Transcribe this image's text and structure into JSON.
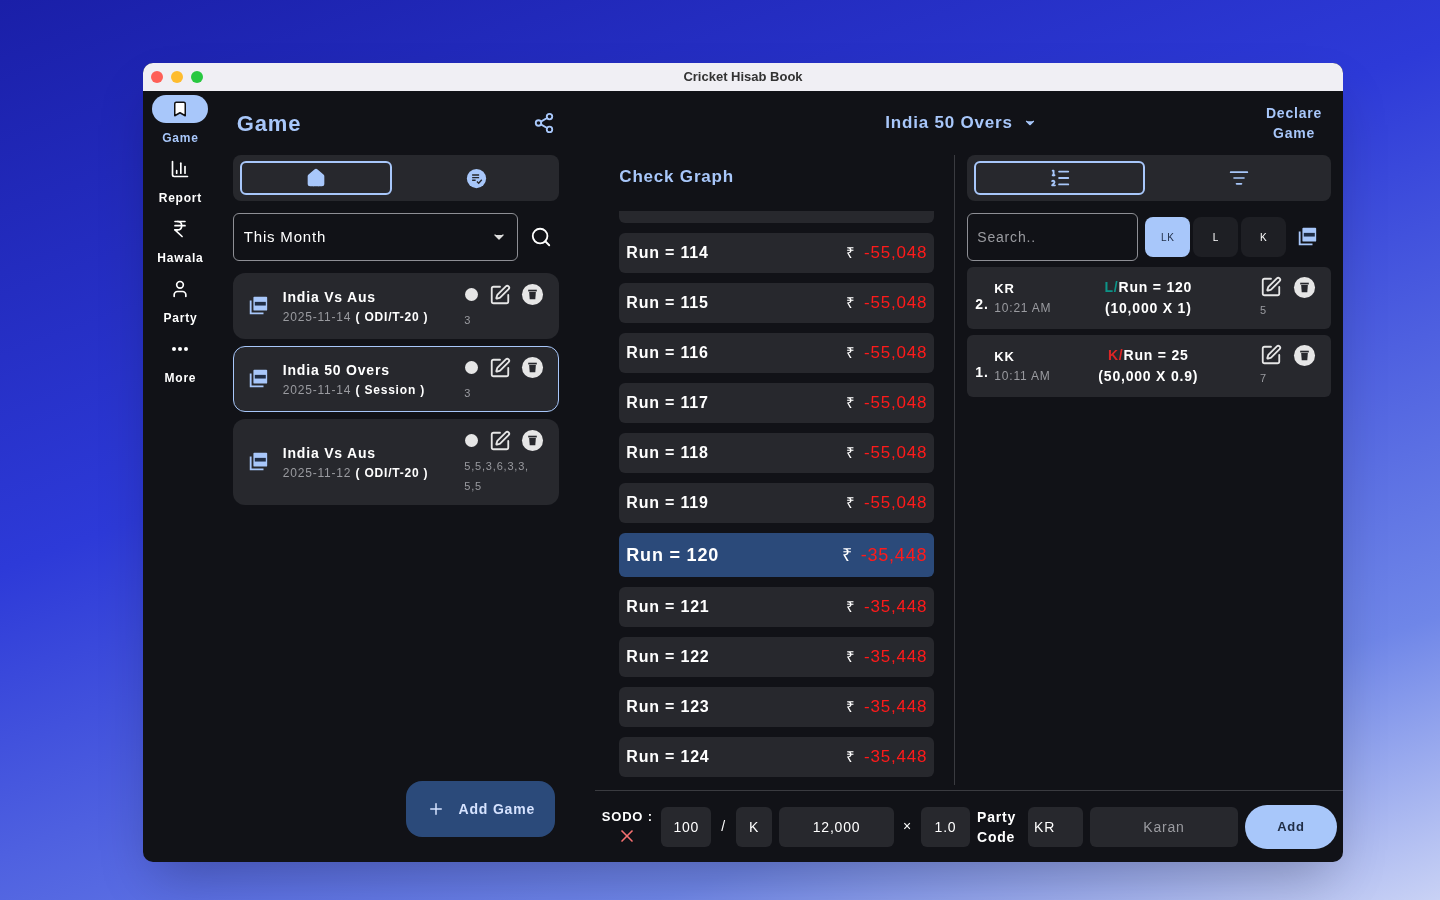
{
  "window": {
    "title": "Cricket Hisab Book"
  },
  "nav": [
    {
      "label": "Game",
      "kind": "book",
      "selected": true
    },
    {
      "label": "Report",
      "kind": "chart",
      "selected": false
    },
    {
      "label": "Hawala",
      "kind": "rupee",
      "selected": false
    },
    {
      "label": "Party",
      "kind": "person",
      "selected": false
    },
    {
      "label": "More",
      "kind": "more",
      "selected": false
    }
  ],
  "left": {
    "title": "Game",
    "tabs": [
      {
        "kind": "home",
        "selected": true
      },
      {
        "kind": "receipt",
        "selected": false
      }
    ],
    "period": {
      "value": "This Month"
    },
    "games": [
      {
        "name": "India Vs Aus",
        "date": "2025-11-14",
        "type": "( ODI/T-20 )",
        "note": "3",
        "selected": false
      },
      {
        "name": "India 50 Overs",
        "date": "2025-11-14",
        "type": "( Session )",
        "note": "3",
        "selected": true
      },
      {
        "name": "India Vs Aus",
        "date": "2025-11-12",
        "type": "( ODI/T-20 )",
        "note": "5,5,3,6,3,3, 5,5",
        "selected": false
      }
    ],
    "add_button": "Add Game"
  },
  "header": {
    "game": "India 50 Overs",
    "declare": "Declare Game"
  },
  "graph": {
    "title": "Check Graph",
    "rows": [
      {
        "run": "Run = 114",
        "currency": "₹",
        "amount": "-55,048",
        "selected": false
      },
      {
        "run": "Run = 115",
        "currency": "₹",
        "amount": "-55,048",
        "selected": false
      },
      {
        "run": "Run = 116",
        "currency": "₹",
        "amount": "-55,048",
        "selected": false
      },
      {
        "run": "Run = 117",
        "currency": "₹",
        "amount": "-55,048",
        "selected": false
      },
      {
        "run": "Run = 118",
        "currency": "₹",
        "amount": "-55,048",
        "selected": false
      },
      {
        "run": "Run = 119",
        "currency": "₹",
        "amount": "-55,048",
        "selected": false
      },
      {
        "run": "Run = 120",
        "currency": "₹",
        "amount": "-35,448",
        "selected": true
      },
      {
        "run": "Run = 121",
        "currency": "₹",
        "amount": "-35,448",
        "selected": false
      },
      {
        "run": "Run = 122",
        "currency": "₹",
        "amount": "-35,448",
        "selected": false
      },
      {
        "run": "Run = 123",
        "currency": "₹",
        "amount": "-35,448",
        "selected": false
      },
      {
        "run": "Run = 124",
        "currency": "₹",
        "amount": "-35,448",
        "selected": false
      }
    ]
  },
  "entries_panel": {
    "tabs": [
      {
        "kind": "list",
        "selected": true
      },
      {
        "kind": "filter",
        "selected": false
      }
    ],
    "search": {
      "placeholder": "Search.."
    },
    "filters": [
      {
        "label": "LK",
        "selected": true
      },
      {
        "label": "L",
        "selected": false
      },
      {
        "label": "K",
        "selected": false
      }
    ],
    "entries": [
      {
        "index": "2.",
        "party": "KR",
        "time": "10:21 AM",
        "side": "L/",
        "color": "#0d9488",
        "bet": "Run = 120",
        "detail": "(10,000 X 1)",
        "count": "5"
      },
      {
        "index": "1.",
        "party": "KK",
        "time": "10:11 AM",
        "side": "K/",
        "color": "#dc2626",
        "bet": "Run = 25",
        "detail": "(50,000 X 0.9)",
        "count": "7"
      }
    ]
  },
  "sodo": {
    "label": "SODO :",
    "run": "100",
    "slash": "/",
    "side": "K",
    "amount": "12,000",
    "times": "×",
    "rate": "1.0",
    "party_label": "Party Code",
    "party_code": "KR",
    "party_name_placeholder": "Karan",
    "add": "Add"
  }
}
